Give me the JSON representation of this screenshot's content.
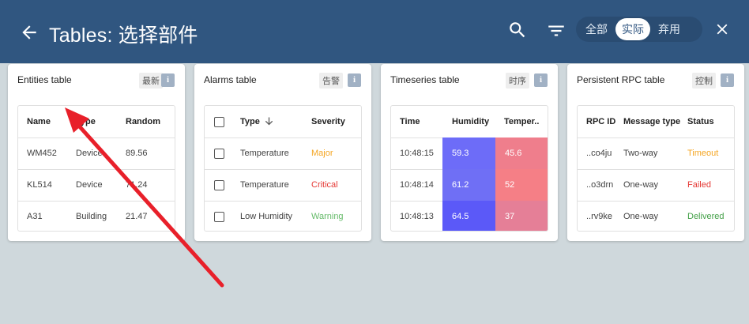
{
  "header": {
    "title": "Tables: 选择部件",
    "toggle": [
      "全部",
      "实际",
      "弃用"
    ],
    "toggle_active": "实际"
  },
  "cards": [
    {
      "title": "Entities table",
      "badge": "最新",
      "info": "i",
      "columns": [
        "Name",
        "Type",
        "Random"
      ],
      "rows": [
        [
          "WM452",
          "Device",
          "89.56"
        ],
        [
          "KL514",
          "Device",
          "71.24"
        ],
        [
          "A31",
          "Building",
          "21.47"
        ]
      ]
    },
    {
      "title": "Alarms table",
      "badge": "告警",
      "info": "i",
      "columns": [
        "Type",
        "Severity"
      ],
      "rows": [
        [
          "Temperature",
          "Major"
        ],
        [
          "Temperature",
          "Critical"
        ],
        [
          "Low Humidity",
          "Warning"
        ]
      ],
      "severity_colors": {
        "Major": "#f5a623",
        "Critical": "#e53935",
        "Warning": "#66bb6a"
      }
    },
    {
      "title": "Timeseries table",
      "badge": "时序",
      "info": "i",
      "columns": [
        "Time",
        "Humidity",
        "Temper.."
      ],
      "rows": [
        [
          "10:48:15",
          "59.3",
          "45.6"
        ],
        [
          "10:48:14",
          "61.2",
          "52"
        ],
        [
          "10:48:13",
          "64.5",
          "37"
        ]
      ],
      "humidity_colors": [
        "#6d6cf8",
        "#6f6ff5",
        "#5b59f8"
      ],
      "temperature_colors": [
        "#ef7e8c",
        "#f57f86",
        "#e57f97"
      ]
    },
    {
      "title": "Persistent RPC table",
      "badge": "控制",
      "info": "i",
      "columns": [
        "RPC ID",
        "Message type",
        "Status"
      ],
      "rows": [
        [
          "..co4ju",
          "Two-way",
          "Timeout"
        ],
        [
          "..o3drn",
          "One-way",
          "Failed"
        ],
        [
          "..rv9ke",
          "One-way",
          "Delivered"
        ]
      ],
      "status_colors": {
        "Timeout": "#f5a623",
        "Failed": "#e53935",
        "Delivered": "#43a047"
      }
    }
  ],
  "colors": {
    "header_bg": "#305680",
    "page_bg": "#cfd8dc",
    "annotation_arrow": "#e8202a"
  }
}
